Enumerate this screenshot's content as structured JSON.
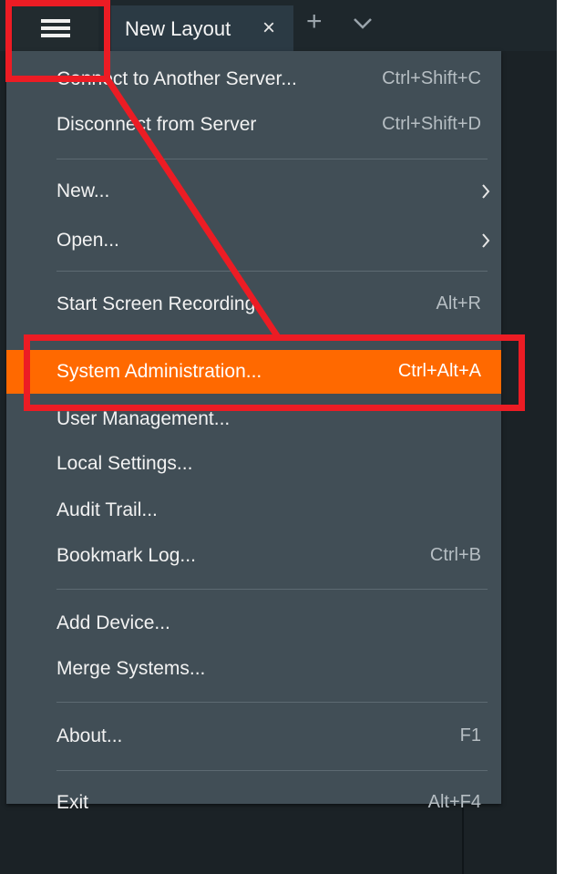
{
  "topbar": {
    "tab_label": "New Layout",
    "tab_close": "×",
    "new_tab": "+"
  },
  "menu": {
    "items": [
      {
        "label": "Connect to Another Server...",
        "shortcut": "Ctrl+Shift+C"
      },
      {
        "label": "Disconnect from Server",
        "shortcut": "Ctrl+Shift+D"
      },
      {
        "label": "New...",
        "shortcut": ""
      },
      {
        "label": "Open...",
        "shortcut": ""
      },
      {
        "label": "Start Screen Recording",
        "shortcut": "Alt+R"
      },
      {
        "label": "System Administration...",
        "shortcut": "Ctrl+Alt+A"
      },
      {
        "label": "User Management...",
        "shortcut": ""
      },
      {
        "label": "Local Settings...",
        "shortcut": ""
      },
      {
        "label": "Audit Trail...",
        "shortcut": ""
      },
      {
        "label": "Bookmark Log...",
        "shortcut": "Ctrl+B"
      },
      {
        "label": "Add Device...",
        "shortcut": ""
      },
      {
        "label": "Merge Systems...",
        "shortcut": ""
      },
      {
        "label": "About...",
        "shortcut": "F1"
      },
      {
        "label": "Exit",
        "shortcut": "Alt+F4"
      }
    ]
  },
  "colors": {
    "accent": "#ff6900",
    "menu_bg": "#414e56",
    "annotation": "#ec1c24"
  }
}
